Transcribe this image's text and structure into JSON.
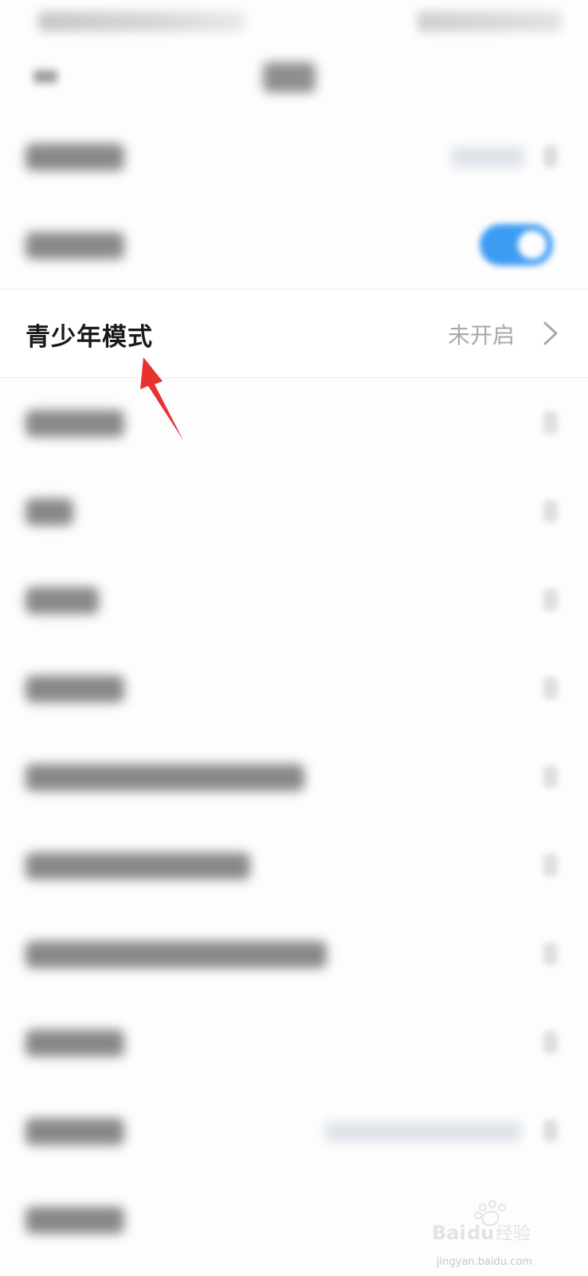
{
  "settings": {
    "teen_mode": {
      "label": "青少年模式",
      "status": "未开启"
    }
  },
  "colors": {
    "toggle_on": "#3c9cf3",
    "annotation_arrow": "#e8322e",
    "focus_label": "#1a1a1a",
    "focus_value": "#a8a8a8"
  },
  "icons": {
    "back": "back-arrow-icon",
    "chevron": "chevron-right-icon",
    "annotation": "red-pointer-arrow"
  },
  "watermark": {
    "brand": "Baidu经验",
    "domain": "jingyan.baidu.com"
  }
}
